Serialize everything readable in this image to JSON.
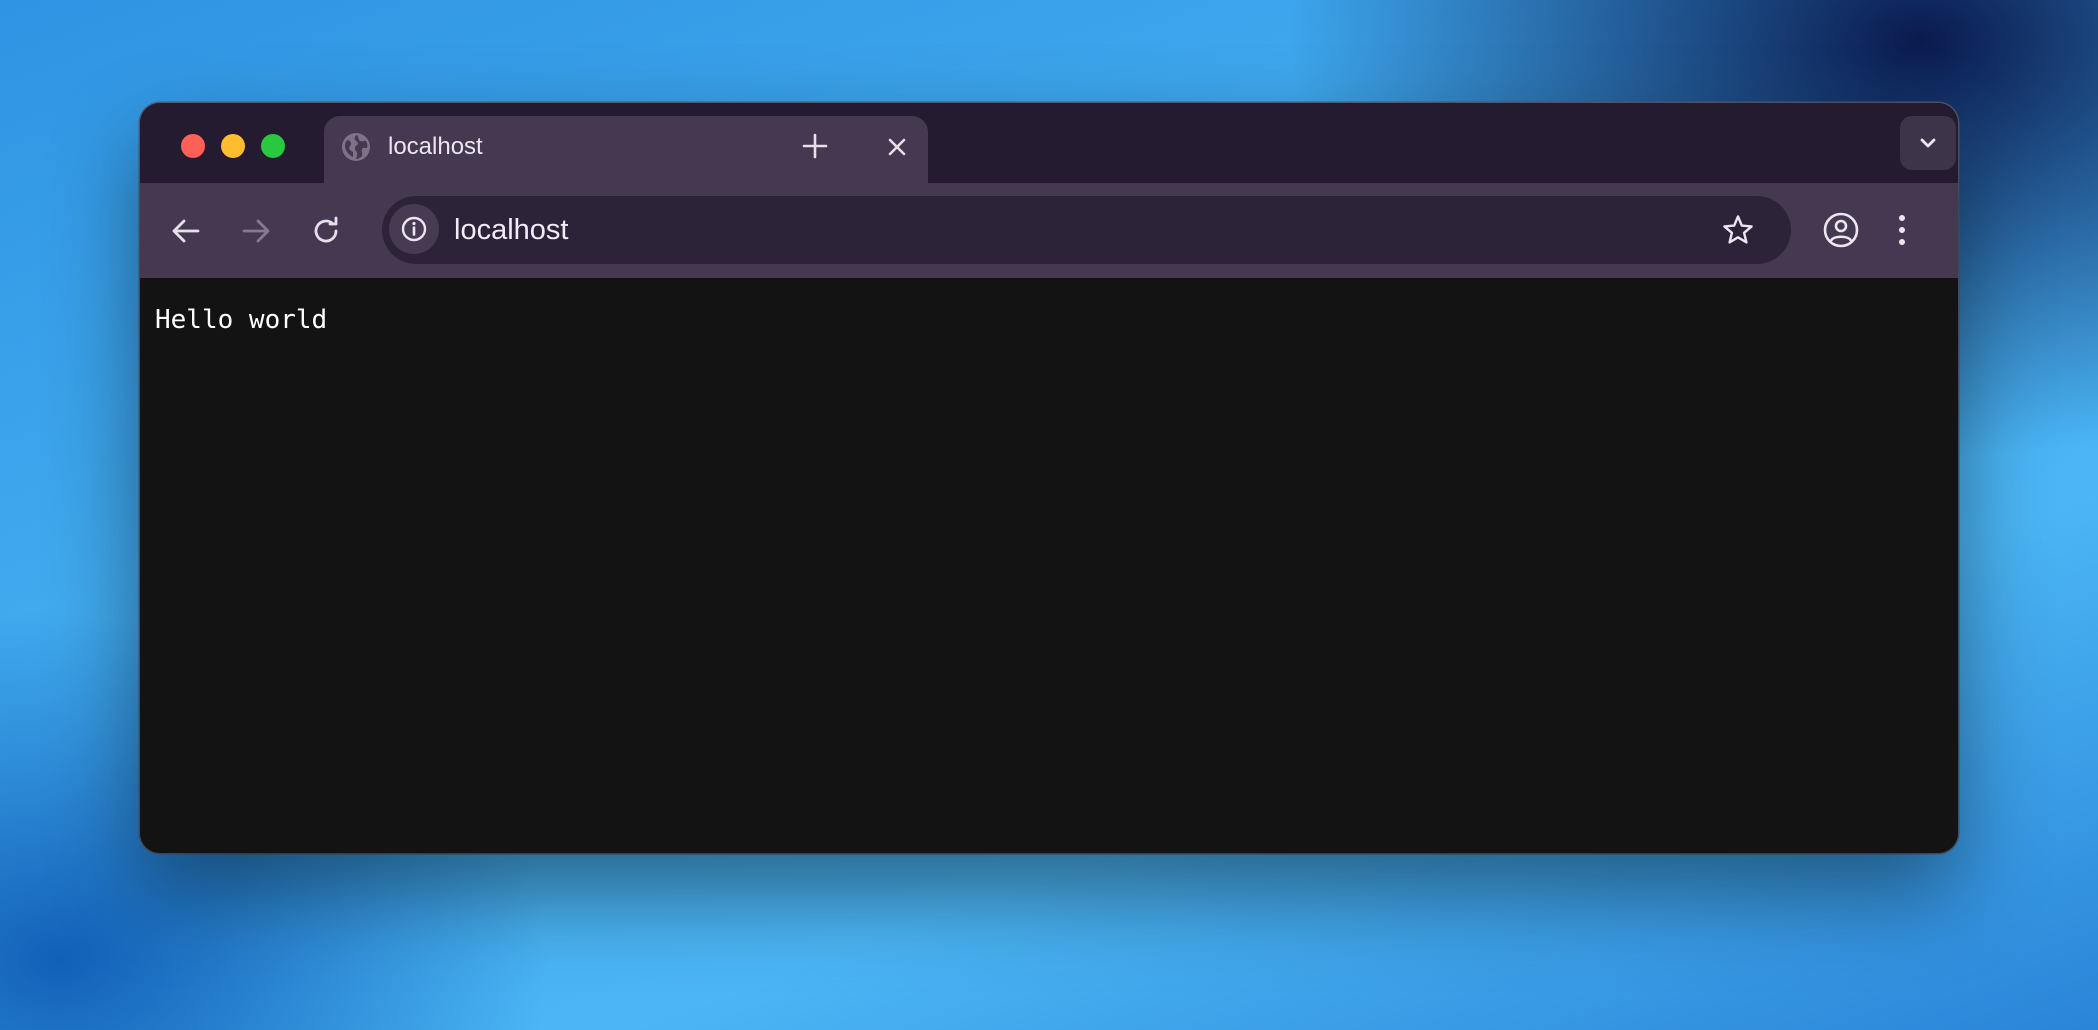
{
  "window": {
    "controls": {
      "close_color": "#fe5f57",
      "minimize_color": "#febc2e",
      "zoom_color": "#28c840"
    }
  },
  "tabs": [
    {
      "title": "localhost",
      "favicon": "globe-icon",
      "active": true
    }
  ],
  "tab_bar": {
    "new_tab_icon": "plus-icon",
    "tab_search_icon": "chevron-down-icon"
  },
  "toolbar": {
    "back_icon": "arrow-left-icon",
    "forward_icon": "arrow-right-icon",
    "forward_enabled": false,
    "reload_icon": "reload-icon",
    "site_info_icon": "info-icon",
    "url": "localhost",
    "bookmark_icon": "star-icon",
    "profile_icon": "account-circle-icon",
    "menu_icon": "kebab-menu-icon"
  },
  "page": {
    "text": "Hello world"
  },
  "colors": {
    "titlebar": "#241b30",
    "toolbar": "#443950",
    "omnibox": "#2d2338",
    "content_background": "#131313"
  }
}
